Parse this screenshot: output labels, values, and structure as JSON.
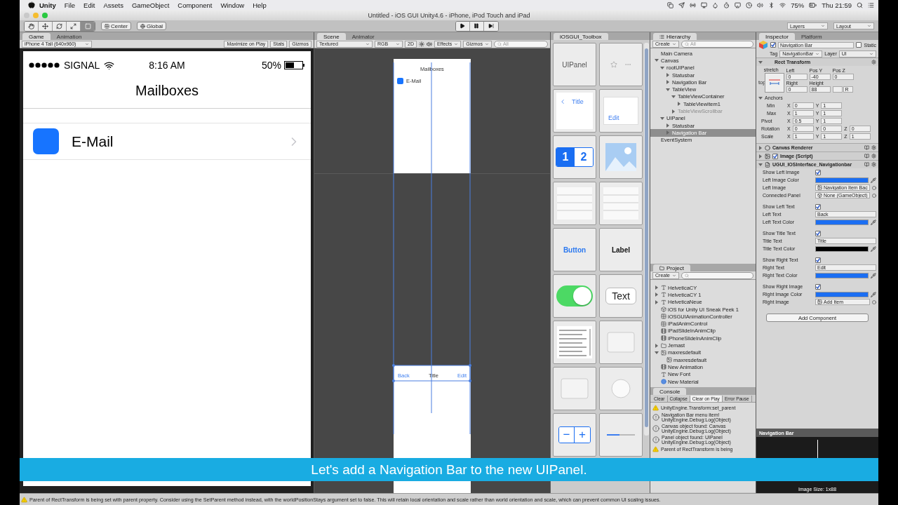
{
  "menu_bar": {
    "app_name": "Unity",
    "items": [
      "File",
      "Edit",
      "Assets",
      "GameObject",
      "Component",
      "Window",
      "Help"
    ],
    "battery": "75%",
    "clock": "Thu 21:59"
  },
  "window": {
    "title": "Untitled - iOS GUI Unity4.6 - iPhone, iPod Touch and iPad"
  },
  "toolbar": {
    "tools": [
      {
        "kind": "hand",
        "selected": false
      },
      {
        "kind": "move",
        "selected": false
      },
      {
        "kind": "rotate",
        "selected": false
      },
      {
        "kind": "scale",
        "selected": false
      },
      {
        "kind": "rect",
        "selected": true
      }
    ],
    "pivot": "Center",
    "space": "Global",
    "layers": "Layers",
    "layout": "Layout"
  },
  "game": {
    "tabs": [
      {
        "label": "Game",
        "selected": true
      },
      {
        "label": "Animation",
        "selected": false
      }
    ],
    "aspect": "iPhone 4 Tall (640x960)",
    "buttons": [
      "Maximize on Play",
      "Stats",
      "Gizmos"
    ],
    "phone": {
      "carrier": "SIGNAL",
      "time": "8:16 AM",
      "battery": "50%",
      "title": "Mailboxes",
      "rows": [
        {
          "label": "E-Mail"
        }
      ]
    }
  },
  "scene": {
    "tabs": [
      {
        "label": "Scene",
        "selected": true
      },
      {
        "label": "Animator",
        "selected": false
      }
    ],
    "shading": "Textured",
    "color_mode": "RGB",
    "mode_2d": "2D",
    "effects": "Effects",
    "gizmos": "Gizmos",
    "search_placeholder": "All",
    "preview": {
      "title": "Mailboxes",
      "row": "E-Mail",
      "nav_left": "Back",
      "nav_title": "Title",
      "nav_right": "Edit"
    }
  },
  "toolbox": {
    "tab": "iOSGUI_Toolbox",
    "tiles": [
      {
        "kind": "panel",
        "label": "UIPanel"
      },
      {
        "kind": "tabbar"
      },
      {
        "kind": "navbar",
        "label": "Title"
      },
      {
        "kind": "field",
        "label": "Edit"
      },
      {
        "kind": "segmented",
        "labels": [
          "1",
          "2"
        ]
      },
      {
        "kind": "image"
      },
      {
        "kind": "table"
      },
      {
        "kind": "table"
      },
      {
        "kind": "button",
        "label": "Button"
      },
      {
        "kind": "label",
        "label": "Label"
      },
      {
        "kind": "switch",
        "on": true
      },
      {
        "kind": "textbox",
        "label": "Text"
      },
      {
        "kind": "textview"
      },
      {
        "kind": "box"
      },
      {
        "kind": "box"
      },
      {
        "kind": "knob"
      },
      {
        "kind": "stepper",
        "labels": [
          "−",
          "+"
        ]
      },
      {
        "kind": "slider"
      }
    ]
  },
  "hierarchy": {
    "tab": "Hierarchy",
    "create": "Create",
    "search_placeholder": "All",
    "items": [
      {
        "label": "Main Camera",
        "selected": false,
        "disabled": false
      },
      {
        "label": "Canvas",
        "expanded": true,
        "selected": false,
        "disabled": false,
        "children": [
          {
            "label": "rootUIPanel",
            "expanded": true,
            "selected": false,
            "disabled": false,
            "children": [
              {
                "label": "Statusbar",
                "expanded": false,
                "selected": false,
                "disabled": false
              },
              {
                "label": "Navigation Bar",
                "expanded": false,
                "selected": false,
                "disabled": false
              },
              {
                "label": "TableView",
                "expanded": true,
                "selected": false,
                "disabled": false,
                "children": [
                  {
                    "label": "TableViewContainer",
                    "expanded": true,
                    "selected": false,
                    "disabled": false,
                    "children": [
                      {
                        "label": "TableViewItem1",
                        "expanded": false,
                        "selected": false,
                        "disabled": false
                      }
                    ]
                  },
                  {
                    "label": "TableViewScrollbar",
                    "expanded": false,
                    "selected": false,
                    "disabled": true
                  }
                ]
              }
            ]
          },
          {
            "label": "UIPanel",
            "expanded": true,
            "selected": false,
            "disabled": false,
            "children": [
              {
                "label": "Statusbar",
                "expanded": false,
                "selected": false,
                "disabled": false
              },
              {
                "label": "Navigation Bar",
                "expanded": false,
                "selected": true,
                "disabled": false
              }
            ]
          }
        ]
      },
      {
        "label": "EventSystem",
        "selected": false,
        "disabled": false
      }
    ]
  },
  "project": {
    "tab": "Project",
    "create": "Create",
    "items": [
      {
        "kind": "font",
        "label": "HelveticaCY",
        "expanded": false
      },
      {
        "kind": "font",
        "label": "HelveticaCY 1",
        "expanded": false
      },
      {
        "kind": "font",
        "label": "HelveticaNeue",
        "expanded": false
      },
      {
        "kind": "scene",
        "label": "iOS for Unity UI Sneak Peek 1"
      },
      {
        "kind": "animator",
        "label": "iOSGUIAnimationController"
      },
      {
        "kind": "animator",
        "label": "iPadAnimControl"
      },
      {
        "kind": "clip",
        "label": "iPadSlideInAnimClip"
      },
      {
        "kind": "clip",
        "label": "iPhoneSlideInAnimClip"
      },
      {
        "kind": "folder",
        "label": "Jemast",
        "expanded": false
      },
      {
        "kind": "texture",
        "label": "maxresdefault",
        "expanded": true,
        "children": [
          {
            "kind": "sprite",
            "label": "maxresdefault"
          }
        ]
      },
      {
        "kind": "clip",
        "label": "New Animation"
      },
      {
        "kind": "font",
        "label": "New Font"
      },
      {
        "kind": "material",
        "label": "New Material"
      }
    ]
  },
  "console": {
    "tab": "Console",
    "buttons": [
      {
        "label": "Clear",
        "on": false
      },
      {
        "label": "Collapse",
        "on": false
      },
      {
        "label": "Clear on Play",
        "on": true
      },
      {
        "label": "Error Pause",
        "on": false
      }
    ],
    "entries": [
      {
        "kind": "warning",
        "lines": [
          "UnityEngine.Transform:set_parent"
        ]
      },
      {
        "kind": "info",
        "lines": [
          "Navigation Bar menu item!",
          "UnityEngine.Debug:Log(Object)"
        ]
      },
      {
        "kind": "info",
        "lines": [
          "Canvas object found: Canvas",
          "UnityEngine.Debug:Log(Object)"
        ]
      },
      {
        "kind": "info",
        "lines": [
          "Panel object found: UIPanel",
          "UnityEngine.Debug:Log(Object)"
        ]
      },
      {
        "kind": "warning",
        "lines": [
          "Parent of RectTransform is being"
        ]
      }
    ]
  },
  "inspector": {
    "tabs": [
      {
        "label": "Inspector",
        "selected": true
      },
      {
        "label": "Platform",
        "selected": false
      }
    ],
    "object": {
      "active": true,
      "name": "Navigation Bar",
      "static": false,
      "static_label": "Static",
      "tag_label": "Tag",
      "tag": "NavigationBar",
      "layer_label": "Layer",
      "layer": "UI"
    },
    "rect_transform": {
      "title": "Rect Transform",
      "anchor_preset": "stretch",
      "anchor_side": "top",
      "fields": [
        {
          "label": "Left",
          "value": "0"
        },
        {
          "label": "Pos Y",
          "value": "-40"
        },
        {
          "label": "Pos Z",
          "value": "0"
        },
        {
          "label": "Right",
          "value": "0"
        },
        {
          "label": "Height",
          "value": "88"
        }
      ],
      "raw_button": "R",
      "anchors": {
        "label": "Anchors",
        "expanded": true,
        "rows": [
          {
            "label": "Min",
            "values": [
              {
                "axis": "X",
                "value": "0"
              },
              {
                "axis": "Y",
                "value": "1"
              }
            ]
          },
          {
            "label": "Max",
            "values": [
              {
                "axis": "X",
                "value": "1"
              },
              {
                "axis": "Y",
                "value": "1"
              }
            ]
          }
        ]
      },
      "rows": [
        {
          "label": "Pivot",
          "values": [
            {
              "axis": "X",
              "value": "0.5"
            },
            {
              "axis": "Y",
              "value": "1"
            }
          ]
        },
        {
          "label": "Rotation",
          "values": [
            {
              "axis": "X",
              "value": "0"
            },
            {
              "axis": "Y",
              "value": "0"
            },
            {
              "axis": "Z",
              "value": "0"
            }
          ]
        },
        {
          "label": "Scale",
          "values": [
            {
              "axis": "X",
              "value": "1"
            },
            {
              "axis": "Y",
              "value": "1"
            },
            {
              "axis": "Z",
              "value": "1"
            }
          ]
        }
      ]
    },
    "components": [
      {
        "kind": "renderer",
        "title": "Canvas Renderer",
        "expanded": false
      },
      {
        "kind": "image",
        "title": "Image (Script)",
        "expanded": false,
        "enabled": true
      },
      {
        "kind": "script",
        "title": "UGUI_IOSInterface_Navigationbar",
        "expanded": true
      }
    ],
    "properties": [
      [
        {
          "kind": "check",
          "label": "Show Left Image",
          "checked": true
        },
        {
          "kind": "color",
          "label": "Left Image Color",
          "color": "#1b6ef2"
        },
        {
          "kind": "sprite",
          "label": "Left Image",
          "value": "Navigation Item Bac"
        },
        {
          "kind": "gameobject",
          "label": "Connected Panel",
          "value": "None (GameObject)"
        }
      ],
      [
        {
          "kind": "check",
          "label": "Show Left Text",
          "checked": true
        },
        {
          "kind": "text",
          "label": "Left Text",
          "value": "Back"
        },
        {
          "kind": "color",
          "label": "Left Text Color",
          "color": "#1b6ef2"
        }
      ],
      [
        {
          "kind": "check",
          "label": "Show Title Text",
          "checked": true
        },
        {
          "kind": "text",
          "label": "Title Text",
          "value": "Title"
        },
        {
          "kind": "color",
          "label": "Title Text Color",
          "color": "#000000"
        }
      ],
      [
        {
          "kind": "check",
          "label": "Show Right Text",
          "checked": true
        },
        {
          "kind": "text",
          "label": "Right Text",
          "value": "Edit"
        },
        {
          "kind": "color",
          "label": "Right Text Color",
          "color": "#1b6ef2"
        }
      ],
      [
        {
          "kind": "check",
          "label": "Show Right Image",
          "checked": true
        },
        {
          "kind": "color",
          "label": "Right Image Color",
          "color": "#1b6ef2"
        },
        {
          "kind": "sprite",
          "label": "Right Image",
          "value": "Add Item"
        }
      ]
    ],
    "add_component": "Add Component",
    "preview": {
      "title": "Navigation Bar",
      "caption": "Image Size: 1x88"
    }
  },
  "caption": "Let's add a Navigation Bar to the new UIPanel.",
  "status_bar": "Parent of RectTransform is being set with parent property. Consider using the SetParent method instead, with the worldPositionStays argument set to false. This will retain local orientation and scale rather than world orientation and scale, which can prevent common UI scaling issues."
}
